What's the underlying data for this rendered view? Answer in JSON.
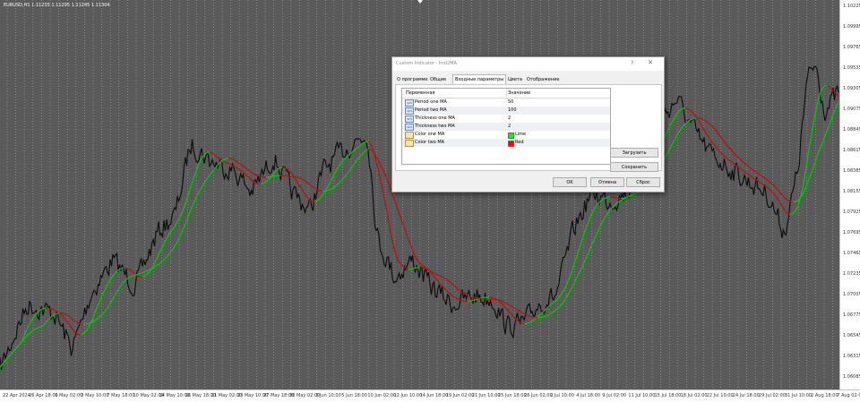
{
  "chart": {
    "symbol_info": "EURUSD,H1  1.11235 1.11295 1.11245 1.11304",
    "colors": {
      "background": "#5a5a5a",
      "price": "#0a0a0a",
      "grid": "#a8a8a8",
      "ma_bull": "#00c800",
      "ma_bear": "#b41414"
    },
    "price_labels": [
      "1.10225",
      "1.09995",
      "1.09765",
      "1.09535",
      "1.09305",
      "1.09075",
      "1.08845",
      "1.08615",
      "1.08385",
      "1.08155",
      "1.07925",
      "1.07695",
      "1.07465",
      "1.07235",
      "1.07005",
      "1.06775",
      "1.06545",
      "1.06315",
      "1.06085"
    ],
    "time_labels": [
      "22 Apr 2024",
      "26 Apr 18:00",
      "1 May 02:00",
      "3 May 10:00",
      "7 May 18:00",
      "10 May 02:00",
      "14 May 10:00",
      "16 May 18:00",
      "21 May 02:00",
      "23 May 10:00",
      "27 May 18:00",
      "30 May 02:00",
      "3 Jun 10:00",
      "5 Jun 18:00",
      "10 Jun 02:00",
      "12 Jun 10:00",
      "14 Jun 18:00",
      "19 Jun 02:00",
      "21 Jun 10:00",
      "25 Jun 18:00",
      "28 Jun 02:00",
      "2 Jul 10:00",
      "4 Jul 18:00",
      "9 Jul 02:00",
      "11 Jul 10:00",
      "15 Jul 18:00",
      "18 Jul 02:00",
      "22 Jul 10:00",
      "24 Jul 18:00",
      "29 Jul 02:00",
      "31 Jul 10:00",
      "2 Aug 18:00",
      "7 Aug 02:00"
    ]
  },
  "dialog": {
    "title": "Custom Indicator - Indi2MA",
    "help": "?",
    "close": "✕",
    "tabs": [
      "О программе",
      "Общие",
      "Входные параметры",
      "Цвета",
      "Отображение"
    ],
    "active_tab": 2,
    "table": {
      "headers": {
        "name": "Переменная",
        "value": "Значение"
      },
      "rows": [
        {
          "icon": "int-icon",
          "name": "Period one MA",
          "value": "50"
        },
        {
          "icon": "int-icon",
          "name": "Period two MA",
          "value": "100"
        },
        {
          "icon": "int-icon",
          "name": "Thickness one MA",
          "value": "2"
        },
        {
          "icon": "int-icon",
          "name": "Thickness two MA",
          "value": "2"
        },
        {
          "icon": "color-icon",
          "name": "Color one MA",
          "value": "Lime",
          "swatch": "#00ff00"
        },
        {
          "icon": "color-icon",
          "name": "Color two MA",
          "value": "Red",
          "swatch": "#ff0000"
        }
      ]
    },
    "buttons": {
      "load": "Загрузить",
      "save": "Сохранить",
      "ok": "OK",
      "cancel": "Отмена",
      "reset": "Сброс"
    }
  }
}
